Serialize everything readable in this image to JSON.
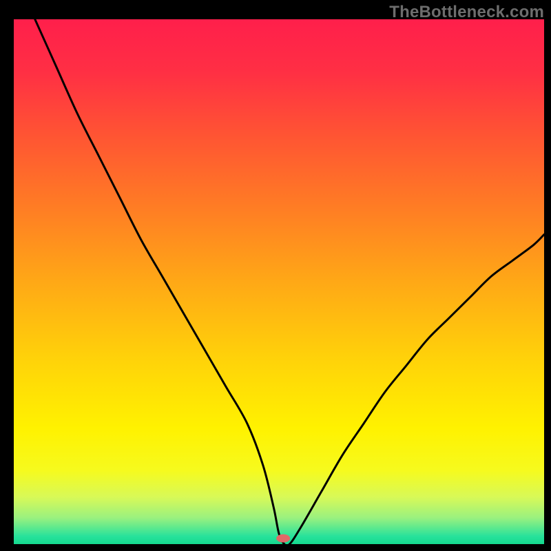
{
  "watermark": "TheBottleneck.com",
  "gradient": {
    "stops": [
      {
        "offset": 0.0,
        "color": "#ff1f4b"
      },
      {
        "offset": 0.1,
        "color": "#ff2f44"
      },
      {
        "offset": 0.22,
        "color": "#ff5433"
      },
      {
        "offset": 0.35,
        "color": "#ff7a25"
      },
      {
        "offset": 0.5,
        "color": "#ffa816"
      },
      {
        "offset": 0.65,
        "color": "#ffd309"
      },
      {
        "offset": 0.78,
        "color": "#fff200"
      },
      {
        "offset": 0.86,
        "color": "#f6fa1e"
      },
      {
        "offset": 0.91,
        "color": "#d8f957"
      },
      {
        "offset": 0.95,
        "color": "#9af17f"
      },
      {
        "offset": 0.985,
        "color": "#28e29b"
      },
      {
        "offset": 1.0,
        "color": "#14d98f"
      }
    ]
  },
  "marker": {
    "x_frac": 0.508,
    "y_frac": 0.989,
    "color": "#e06868",
    "rx": 10,
    "ry": 6
  },
  "chart_data": {
    "type": "line",
    "title": "",
    "xlabel": "",
    "ylabel": "",
    "xlim": [
      0,
      100
    ],
    "ylim": [
      0,
      100
    ],
    "note": "V-shaped bottleneck curve; gradient background red→yellow→green top to bottom; minimum near x≈51%, marked by small pink pill at bottom.",
    "series": [
      {
        "name": "bottleneck-curve",
        "x": [
          4,
          8,
          12,
          16,
          20,
          24,
          28,
          32,
          36,
          40,
          44,
          47,
          49,
          50,
          51,
          52,
          54,
          58,
          62,
          66,
          70,
          74,
          78,
          82,
          86,
          90,
          94,
          98,
          100
        ],
        "y": [
          100,
          91,
          82,
          74,
          66,
          58,
          51,
          44,
          37,
          30,
          23,
          15,
          7,
          2,
          0,
          0,
          3,
          10,
          17,
          23,
          29,
          34,
          39,
          43,
          47,
          51,
          54,
          57,
          59
        ]
      }
    ]
  }
}
